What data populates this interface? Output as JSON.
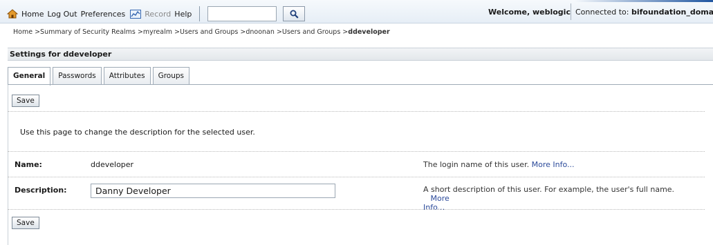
{
  "topnav": {
    "home": "Home",
    "logout": "Log Out",
    "preferences": "Preferences",
    "record": "Record",
    "help": "Help",
    "search_value": ""
  },
  "welcome": "Welcome, weblogic",
  "connected_label": "Connected to:",
  "connected_server": "bifoundation_domain",
  "breadcrumb": {
    "items": [
      "Home >",
      "Summary of Security Realms >",
      "myrealm >",
      "Users and Groups >",
      "dnoonan >",
      "Users and Groups >"
    ],
    "current": "ddeveloper"
  },
  "settings_title": "Settings for ddeveloper",
  "tabs": [
    "General",
    "Passwords",
    "Attributes",
    "Groups"
  ],
  "save_label": "Save",
  "intro": "Use this page to change the description for the selected user.",
  "fields": {
    "name_label": "Name:",
    "name_value": "ddeveloper",
    "name_help": "The login name of this user.",
    "desc_label": "Description:",
    "desc_value": "Danny Developer",
    "desc_help": "A short description of this user. For example, the user's full name.",
    "more_info_name": "More Info...",
    "more_info_desc_1": "More",
    "more_info_desc_2": "Info..."
  },
  "colors": {
    "link": "#2b4a9a",
    "home_icon": "#c97a12",
    "search_icon": "#1f3f7a"
  },
  "icons": [
    "home-icon",
    "record-icon",
    "search-icon"
  ]
}
